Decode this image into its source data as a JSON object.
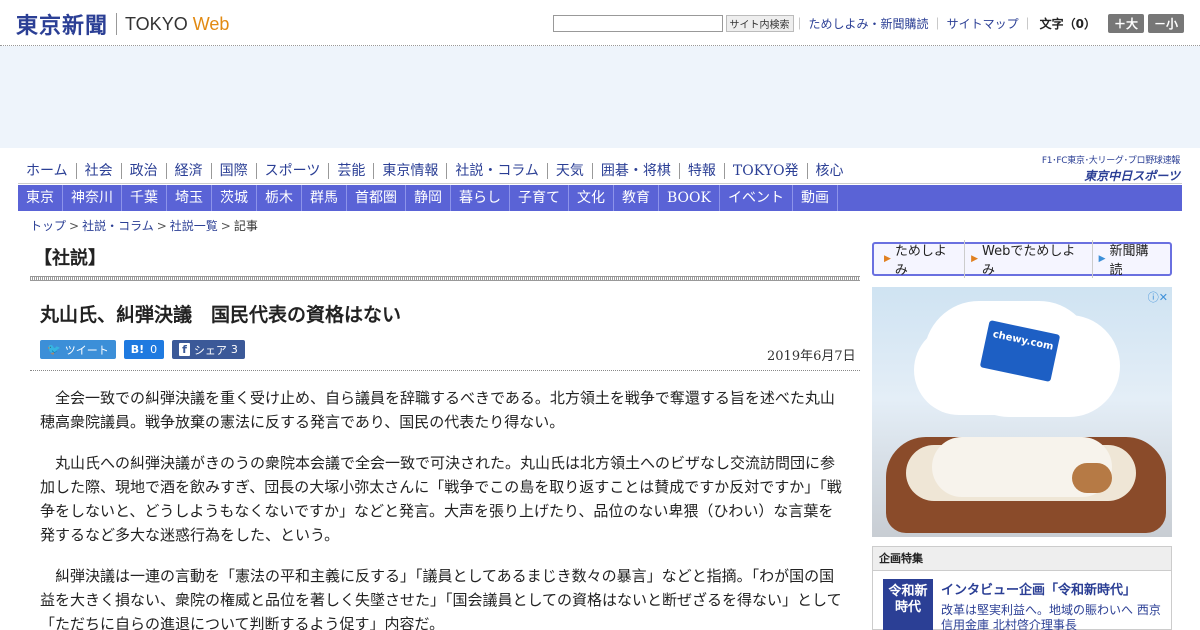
{
  "header": {
    "logo_jp": "東京新聞",
    "logo_en": "TOKYO",
    "logo_web": "Web",
    "search_button": "サイト内検索",
    "links": [
      "ためしよみ・新聞購読",
      "サイトマップ"
    ],
    "font_label": "文字（0）",
    "font_plus": "＋大",
    "font_minus": "－小"
  },
  "nav1": [
    "ホーム",
    "社会",
    "政治",
    "経済",
    "国際",
    "スポーツ",
    "芸能",
    "東京情報",
    "社説・コラム",
    "天気",
    "囲碁・将棋",
    "特報",
    "TOKYO発",
    "核心"
  ],
  "sports": {
    "top": "F1･FC東京･大リーグ･プロ野球速報",
    "main": "東京中日スポーツ"
  },
  "nav2": [
    "東京",
    "神奈川",
    "千葉",
    "埼玉",
    "茨城",
    "栃木",
    "群馬",
    "首都圏",
    "静岡",
    "暮らし",
    "子育て",
    "文化",
    "教育",
    "BOOK",
    "イベント",
    "動画"
  ],
  "breadcrumb": [
    "トップ",
    "社説・コラム",
    "社説一覧",
    "記事"
  ],
  "article": {
    "section": "【社説】",
    "title": "丸山氏、糾弾決議　国民代表の資格はない",
    "share": {
      "tweet": "ツイート",
      "hatena_icon": "B!",
      "hatena_count": "0",
      "fb_label": "シェア",
      "fb_count": "3"
    },
    "date": "2019年6月7日",
    "paragraphs": [
      "全会一致での糾弾決議を重く受け止め、自ら議員を辞職するべきである。北方領土を戦争で奪還する旨を述べた丸山穂高衆院議員。戦争放棄の憲法に反する発言であり、国民の代表たり得ない。",
      "丸山氏への糾弾決議がきのうの衆院本会議で全会一致で可決された。丸山氏は北方領土へのビザなし交流訪問団に参加した際、現地で酒を飲みすぎ、団長の大塚小弥太さんに「戦争でこの島を取り返すことは賛成ですか反対ですか」「戦争をしないと、どうしようもなくないですか」などと発言。大声を張り上げたり、品位のない卑猥（ひわい）な言葉を発するなど多大な迷惑行為をした、という。",
      "糾弾決議は一連の言動を「憲法の平和主義に反する」「議員としてあるまじき数々の暴言」などと指摘。「わが国の国益を大きく損ない、衆院の権威と品位を著しく失墜させた」「国会議員としての資格はないと断ぜざるを得ない」として「ただちに自らの進退について判断するよう促す」内容だ。"
    ]
  },
  "promo": [
    "ためしよみ",
    "Webでためしよみ",
    "新聞購読"
  ],
  "side_ad": {
    "brand": "chewy.com",
    "info": "ⓘ✕"
  },
  "feature": {
    "head": "企画特集",
    "thumb": "令和新時代",
    "title": "インタビュー企画「令和新時代」",
    "desc": "改革は堅実利益へ。地域の賑わいへ 西京信用金庫 北村啓介理事長"
  }
}
